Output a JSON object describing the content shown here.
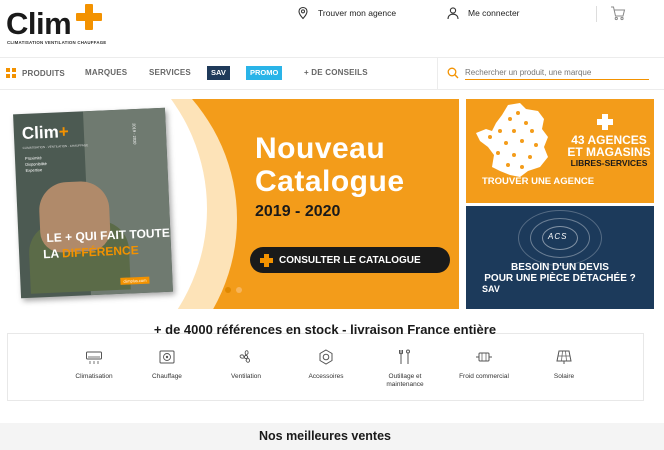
{
  "header": {
    "logo_text": "Clim",
    "logo_tagline": "CLIMATISATION VENTILATION CHAUFFAGE",
    "store_locator_label": "Trouver mon agence",
    "account_label": "Me connecter"
  },
  "nav": {
    "products_label": "PRODUITS",
    "brands_label": "MARQUES",
    "services_label": "SERVICES",
    "sav_label": "SAV",
    "promo_label": "PROMO",
    "advice_label": "+ DE CONSEILS",
    "search_placeholder": "Rechercher un produit, une marque"
  },
  "hero": {
    "catalog_cover": {
      "logo": "Clim",
      "year": "2019 - 2020",
      "tagline": "CLIMATISATION · VENTILATION · CHAUFFAGE",
      "features": [
        "Proximité",
        "Disponibilité",
        "Expertise"
      ],
      "line1": "LE + QUI FAIT TOUTE",
      "line2_prefix": "LA ",
      "line2_highlight": "DIFFÉRENCE",
      "url": "climplus.com"
    },
    "title_line1": "Nouveau",
    "title_line2": "Catalogue",
    "year_range": "2019 - 2020",
    "cta_label": "CONSULTER LE CATALOGUE"
  },
  "promo_tiles": {
    "agencies": {
      "line1": "43 AGENCES",
      "line2": "ET MAGASINS",
      "line3": "LIBRES-SERVICES",
      "cta": "TROUVER UNE AGENCE"
    },
    "spare_parts": {
      "brand": "ACS",
      "line1": "BESOIN D'UN DEVIS",
      "line2": "POUR UNE PIÈCE DÉTACHÉE ?",
      "line3": "SAV"
    }
  },
  "stock_banner": "+ de 4000 références en stock - livraison France entière",
  "categories": [
    {
      "label": "Climatisation",
      "icon": "air-conditioner-icon"
    },
    {
      "label": "Chauffage",
      "icon": "heater-icon"
    },
    {
      "label": "Ventilation",
      "icon": "fan-icon"
    },
    {
      "label": "Accessoires",
      "icon": "nut-icon"
    },
    {
      "label": "Outillage et maintenance",
      "icon": "tools-icon"
    },
    {
      "label": "Froid commercial",
      "icon": "compressor-icon"
    },
    {
      "label": "Solaire",
      "icon": "solar-panel-icon"
    }
  ],
  "best_sellers_title": "Nos meilleures ventes",
  "colors": {
    "brand_orange": "#f39200",
    "navy": "#1c3a5b",
    "promo_blue": "#2ab4e8",
    "hero_orange": "#f39c1a"
  }
}
